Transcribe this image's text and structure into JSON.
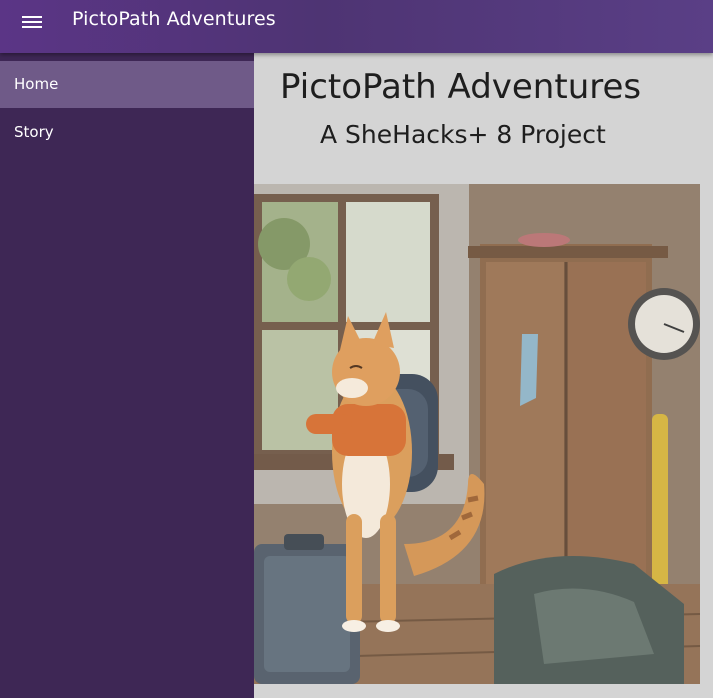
{
  "appbar": {
    "title": "PictoPath Adventures",
    "menu_icon": "hamburger-menu-icon"
  },
  "sidebar": {
    "items": [
      {
        "label": "Home",
        "active": true
      },
      {
        "label": "Story",
        "active": false
      }
    ]
  },
  "main": {
    "title": "PictoPath Adventures",
    "subtitle": "A SheHacks+ 8 Project"
  },
  "hero_image": {
    "alt": "Illustrated cat with a backpack looking out of a window in a wooden room"
  },
  "colors": {
    "appbar": "#4e3473",
    "sidebar": "#3e2755",
    "active_item": "#6f5a88",
    "content_bg": "#d4d4d4"
  }
}
